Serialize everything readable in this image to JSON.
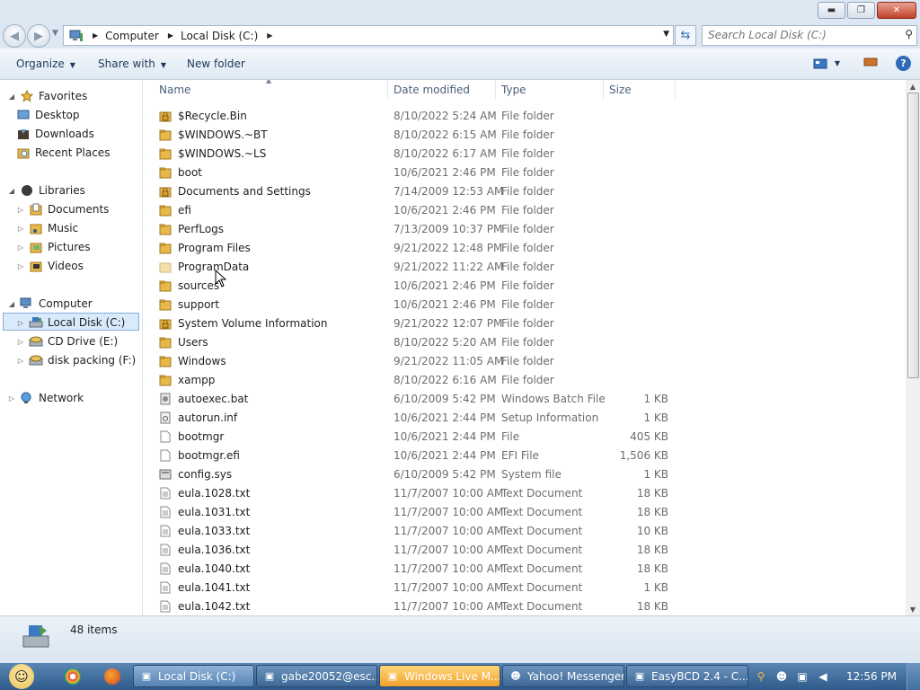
{
  "window": {
    "minimize_glyph": "▬",
    "maximize_glyph": "❐",
    "close_glyph": "✕"
  },
  "address": {
    "crumbs": [
      "Computer",
      "Local Disk (C:)"
    ],
    "search_placeholder": "Search Local Disk (C:)"
  },
  "toolbar": {
    "organize": "Organize",
    "share_with": "Share with",
    "new_folder": "New folder"
  },
  "sidebar": {
    "favorites": "Favorites",
    "desktop": "Desktop",
    "downloads": "Downloads",
    "recent_places": "Recent Places",
    "libraries": "Libraries",
    "documents": "Documents",
    "music": "Music",
    "pictures": "Pictures",
    "videos": "Videos",
    "computer": "Computer",
    "local_disk": "Local Disk (C:)",
    "cd_drive": "CD Drive (E:)",
    "disk_packing": "disk packing (F:)",
    "network": "Network"
  },
  "columns": {
    "name": "Name",
    "date_modified": "Date modified",
    "type": "Type",
    "size": "Size"
  },
  "files": [
    {
      "name": "$Recycle.Bin",
      "date": "8/10/2022 5:24 AM",
      "type": "File folder",
      "size": "",
      "icon": "locked-folder-icon"
    },
    {
      "name": "$WINDOWS.~BT",
      "date": "8/10/2022 6:15 AM",
      "type": "File folder",
      "size": "",
      "icon": "folder-icon"
    },
    {
      "name": "$WINDOWS.~LS",
      "date": "8/10/2022 6:17 AM",
      "type": "File folder",
      "size": "",
      "icon": "folder-icon"
    },
    {
      "name": "boot",
      "date": "10/6/2021 2:46 PM",
      "type": "File folder",
      "size": "",
      "icon": "folder-icon"
    },
    {
      "name": "Documents and Settings",
      "date": "7/14/2009 12:53 AM",
      "type": "File folder",
      "size": "",
      "icon": "locked-folder-icon"
    },
    {
      "name": "efi",
      "date": "10/6/2021 2:46 PM",
      "type": "File folder",
      "size": "",
      "icon": "folder-icon"
    },
    {
      "name": "PerfLogs",
      "date": "7/13/2009 10:37 PM",
      "type": "File folder",
      "size": "",
      "icon": "folder-icon"
    },
    {
      "name": "Program Files",
      "date": "9/21/2022 12:48 PM",
      "type": "File folder",
      "size": "",
      "icon": "folder-icon"
    },
    {
      "name": "ProgramData",
      "date": "9/21/2022 11:22 AM",
      "type": "File folder",
      "size": "",
      "icon": "hidden-folder-icon"
    },
    {
      "name": "sources",
      "date": "10/6/2021 2:46 PM",
      "type": "File folder",
      "size": "",
      "icon": "folder-icon"
    },
    {
      "name": "support",
      "date": "10/6/2021 2:46 PM",
      "type": "File folder",
      "size": "",
      "icon": "folder-icon"
    },
    {
      "name": "System Volume Information",
      "date": "9/21/2022 12:07 PM",
      "type": "File folder",
      "size": "",
      "icon": "locked-folder-icon"
    },
    {
      "name": "Users",
      "date": "8/10/2022 5:20 AM",
      "type": "File folder",
      "size": "",
      "icon": "folder-icon"
    },
    {
      "name": "Windows",
      "date": "9/21/2022 11:05 AM",
      "type": "File folder",
      "size": "",
      "icon": "folder-icon"
    },
    {
      "name": "xampp",
      "date": "8/10/2022 6:16 AM",
      "type": "File folder",
      "size": "",
      "icon": "folder-icon"
    },
    {
      "name": "autoexec.bat",
      "date": "6/10/2009 5:42 PM",
      "type": "Windows Batch File",
      "size": "1 KB",
      "icon": "batch-file-icon"
    },
    {
      "name": "autorun.inf",
      "date": "10/6/2021 2:44 PM",
      "type": "Setup Information",
      "size": "1 KB",
      "icon": "settings-file-icon"
    },
    {
      "name": "bootmgr",
      "date": "10/6/2021 2:44 PM",
      "type": "File",
      "size": "405 KB",
      "icon": "file-icon"
    },
    {
      "name": "bootmgr.efi",
      "date": "10/6/2021 2:44 PM",
      "type": "EFI File",
      "size": "1,506 KB",
      "icon": "file-icon"
    },
    {
      "name": "config.sys",
      "date": "6/10/2009 5:42 PM",
      "type": "System file",
      "size": "1 KB",
      "icon": "system-file-icon"
    },
    {
      "name": "eula.1028.txt",
      "date": "11/7/2007 10:00 AM",
      "type": "Text Document",
      "size": "18 KB",
      "icon": "text-file-icon"
    },
    {
      "name": "eula.1031.txt",
      "date": "11/7/2007 10:00 AM",
      "type": "Text Document",
      "size": "18 KB",
      "icon": "text-file-icon"
    },
    {
      "name": "eula.1033.txt",
      "date": "11/7/2007 10:00 AM",
      "type": "Text Document",
      "size": "10 KB",
      "icon": "text-file-icon"
    },
    {
      "name": "eula.1036.txt",
      "date": "11/7/2007 10:00 AM",
      "type": "Text Document",
      "size": "18 KB",
      "icon": "text-file-icon"
    },
    {
      "name": "eula.1040.txt",
      "date": "11/7/2007 10:00 AM",
      "type": "Text Document",
      "size": "18 KB",
      "icon": "text-file-icon"
    },
    {
      "name": "eula.1041.txt",
      "date": "11/7/2007 10:00 AM",
      "type": "Text Document",
      "size": "1 KB",
      "icon": "text-file-icon"
    },
    {
      "name": "eula.1042.txt",
      "date": "11/7/2007 10:00 AM",
      "type": "Text Document",
      "size": "18 KB",
      "icon": "text-file-icon"
    }
  ],
  "status": {
    "item_count": "48 items"
  },
  "taskbar": {
    "tasks": [
      {
        "label": "Local Disk (C:)",
        "state": "active",
        "icon": "explorer-icon"
      },
      {
        "label": "gabe20052@esc...",
        "state": "normal",
        "icon": "messenger-icon"
      },
      {
        "label": "Windows Live M...",
        "state": "hot",
        "icon": "messenger-icon"
      },
      {
        "label": "Yahoo! Messenger",
        "state": "normal",
        "icon": "yahoo-icon"
      },
      {
        "label": "EasyBCD 2.4 - C...",
        "state": "normal",
        "icon": "easybcd-icon"
      }
    ],
    "clock": "12:56 PM"
  },
  "colors": {
    "accent": "#2f6ab8",
    "folder": "#e8b84a",
    "selection": "#d9ebfb"
  }
}
